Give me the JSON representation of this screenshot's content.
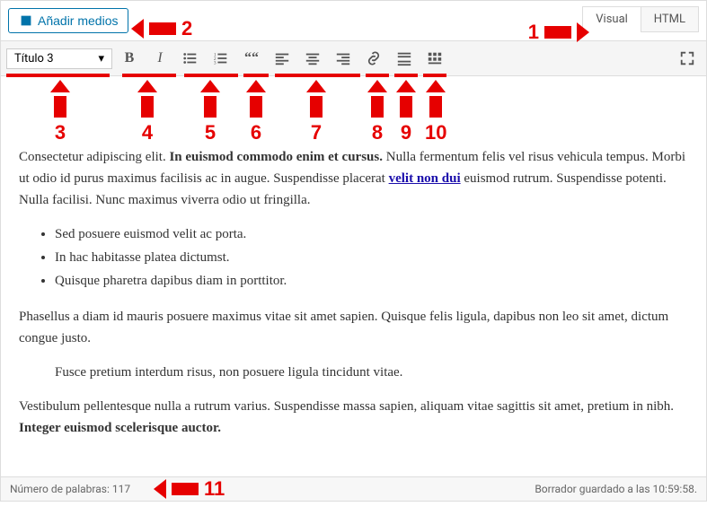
{
  "buttons": {
    "add_media": "Añadir medios"
  },
  "tabs": {
    "visual": "Visual",
    "html": "HTML"
  },
  "toolbar": {
    "format_select": "Título 3"
  },
  "annotations": {
    "n1": "1",
    "n2": "2",
    "n3": "3",
    "n4": "4",
    "n5": "5",
    "n6": "6",
    "n7": "7",
    "n8": "8",
    "n9": "9",
    "n10": "10",
    "n11": "11"
  },
  "content": {
    "p1_a": "Consectetur adipiscing elit. ",
    "p1_b": "In euismod commodo enim et cursus.",
    "p1_c": " Nulla fermentum felis vel risus vehicula tempus. Morbi ut odio id purus maximus facilisis ac in augue. Suspendisse placerat ",
    "p1_link": "velit non dui",
    "p1_d": " euismod rutrum. Suspendisse potenti. Nulla facilisi. Nunc maximus viverra odio ut fringilla.",
    "li1": "Sed posuere euismod velit ac porta.",
    "li2": "In hac habitasse platea dictumst.",
    "li3": "Quisque pharetra dapibus diam in porttitor.",
    "p2": "Phasellus a diam id mauris posuere maximus vitae sit amet sapien. Quisque felis ligula, dapibus non leo sit amet, dictum congue justo.",
    "p3": "Fusce pretium interdum risus, non posuere ligula tincidunt vitae.",
    "p4_a": " Vestibulum pellentesque nulla a rutrum varius. Suspendisse massa sapien, aliquam vitae sagittis sit amet, pretium in nibh. ",
    "p4_b": "Integer euismod scelerisque auctor."
  },
  "status": {
    "word_count_label": "Número de palabras: ",
    "word_count": "117",
    "draft_saved": "Borrador guardado a las 10:59:58."
  }
}
